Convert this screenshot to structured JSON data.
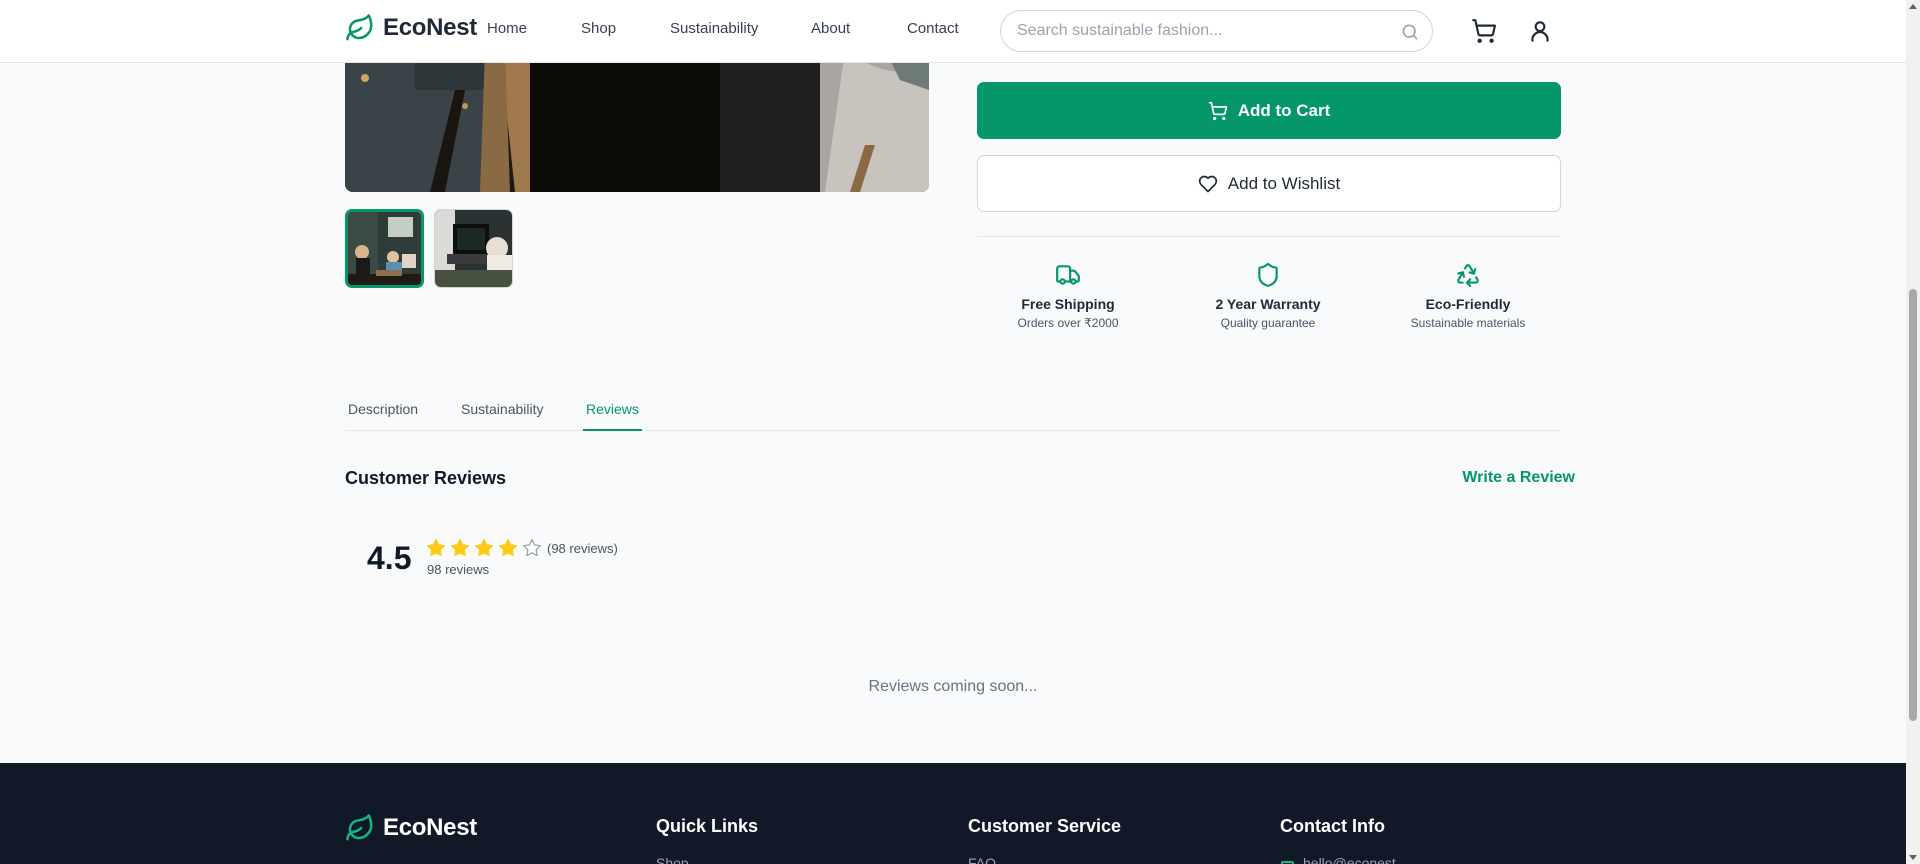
{
  "brand": {
    "name": "EcoNest",
    "accent": "#059669"
  },
  "nav": {
    "items": [
      {
        "label": "Home"
      },
      {
        "label": "Shop"
      },
      {
        "label": "Sustainability"
      },
      {
        "label": "About"
      },
      {
        "label": "Contact"
      }
    ]
  },
  "search": {
    "placeholder": "Search sustainable fashion..."
  },
  "header_icons": [
    "cart-icon",
    "user-icon"
  ],
  "gallery": {
    "thumbnails": [
      {
        "name": "thumbnail-1",
        "active": true
      },
      {
        "name": "thumbnail-2",
        "active": false
      }
    ]
  },
  "actions": {
    "add_to_cart": "Add to Cart",
    "add_to_wishlist": "Add to Wishlist"
  },
  "features": [
    {
      "icon": "truck-icon",
      "title": "Free Shipping",
      "subtitle": "Orders over ₹2000"
    },
    {
      "icon": "shield-icon",
      "title": "2 Year Warranty",
      "subtitle": "Quality guarantee"
    },
    {
      "icon": "recycle-icon",
      "title": "Eco-Friendly",
      "subtitle": "Sustainable materials"
    }
  ],
  "tabs": [
    {
      "label": "Description",
      "active": false
    },
    {
      "label": "Sustainability",
      "active": false
    },
    {
      "label": "Reviews",
      "active": true
    }
  ],
  "reviews": {
    "title": "Customer Reviews",
    "write_review": "Write a Review",
    "rating": "4.5",
    "rating_value": 4.5,
    "filled_stars": 4,
    "total_stars": 5,
    "count_inline": "(98 reviews)",
    "count": "98 reviews",
    "coming_soon": "Reviews coming soon..."
  },
  "footer": {
    "brand": "EcoNest",
    "columns": [
      {
        "title": "Quick Links",
        "first_item": "Shop"
      },
      {
        "title": "Customer Service",
        "first_item": "FAQ"
      },
      {
        "title": "Contact Info",
        "first_item": "hello@econest"
      }
    ]
  }
}
